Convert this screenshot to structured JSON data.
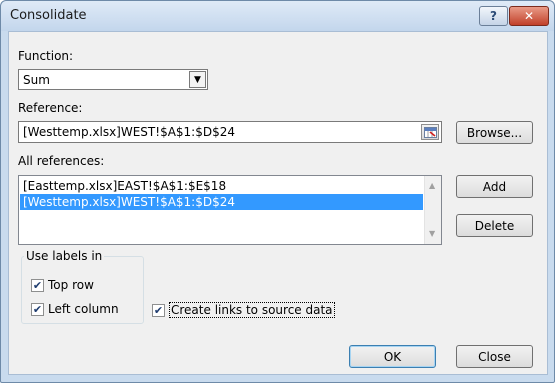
{
  "dialog": {
    "title": "Consolidate",
    "help_symbol": "?",
    "close_symbol": "✕"
  },
  "function": {
    "label": "Function:",
    "value": "Sum"
  },
  "reference": {
    "label": "Reference:",
    "value": "[Westtemp.xlsx]WEST!$A$1:$D$24",
    "browse_label": "Browse..."
  },
  "all_references": {
    "label": "All references:",
    "items": [
      "[Easttemp.xlsx]EAST!$A$1:$E$18",
      "[Westtemp.xlsx]WEST!$A$1:$D$24"
    ],
    "selected_index": 1,
    "add_label": "Add",
    "delete_label": "Delete"
  },
  "labels": {
    "group_title": "Use labels in",
    "top_row": "Top row",
    "top_row_checked": true,
    "left_column": "Left column",
    "left_column_checked": true,
    "create_links": "Create links to source data",
    "create_links_checked": true
  },
  "footer": {
    "ok_label": "OK",
    "close_label": "Close"
  }
}
